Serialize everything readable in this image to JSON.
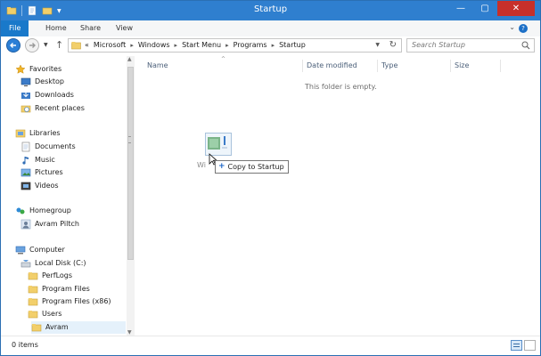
{
  "window": {
    "title": "Startup",
    "controls": {
      "minimize": "—",
      "maximize": "▢",
      "close": "✕"
    }
  },
  "ribbon": {
    "tabs": [
      "File",
      "Home",
      "Share",
      "View"
    ]
  },
  "address": {
    "overflow": "«",
    "crumbs": [
      "Microsoft",
      "Windows",
      "Start Menu",
      "Programs",
      "Startup"
    ]
  },
  "search": {
    "placeholder": "Search Startup"
  },
  "navpane": {
    "favorites": {
      "label": "Favorites",
      "items": [
        "Desktop",
        "Downloads",
        "Recent places"
      ]
    },
    "libraries": {
      "label": "Libraries",
      "items": [
        "Documents",
        "Music",
        "Pictures",
        "Videos"
      ]
    },
    "homegroup": {
      "label": "Homegroup",
      "items": [
        "Avram Piltch"
      ]
    },
    "computer": {
      "label": "Computer",
      "items": [
        "Local Disk (C:)"
      ]
    },
    "local_disk_items": [
      "PerfLogs",
      "Program Files",
      "Program Files (x86)",
      "Users"
    ],
    "users_items": [
      "Avram"
    ]
  },
  "content": {
    "columns": [
      "Name",
      "Date modified",
      "Type",
      "Size"
    ],
    "empty_message": "This folder is empty.",
    "drag_ghost_label": "Wi",
    "drag_tooltip": "Copy to Startup"
  },
  "status": {
    "item_count": "0 items"
  },
  "colors": {
    "titlebar": "#2f7fcf",
    "file_tab": "#1979ca",
    "close_button": "#c7302a",
    "folder": "#e8c15a"
  }
}
